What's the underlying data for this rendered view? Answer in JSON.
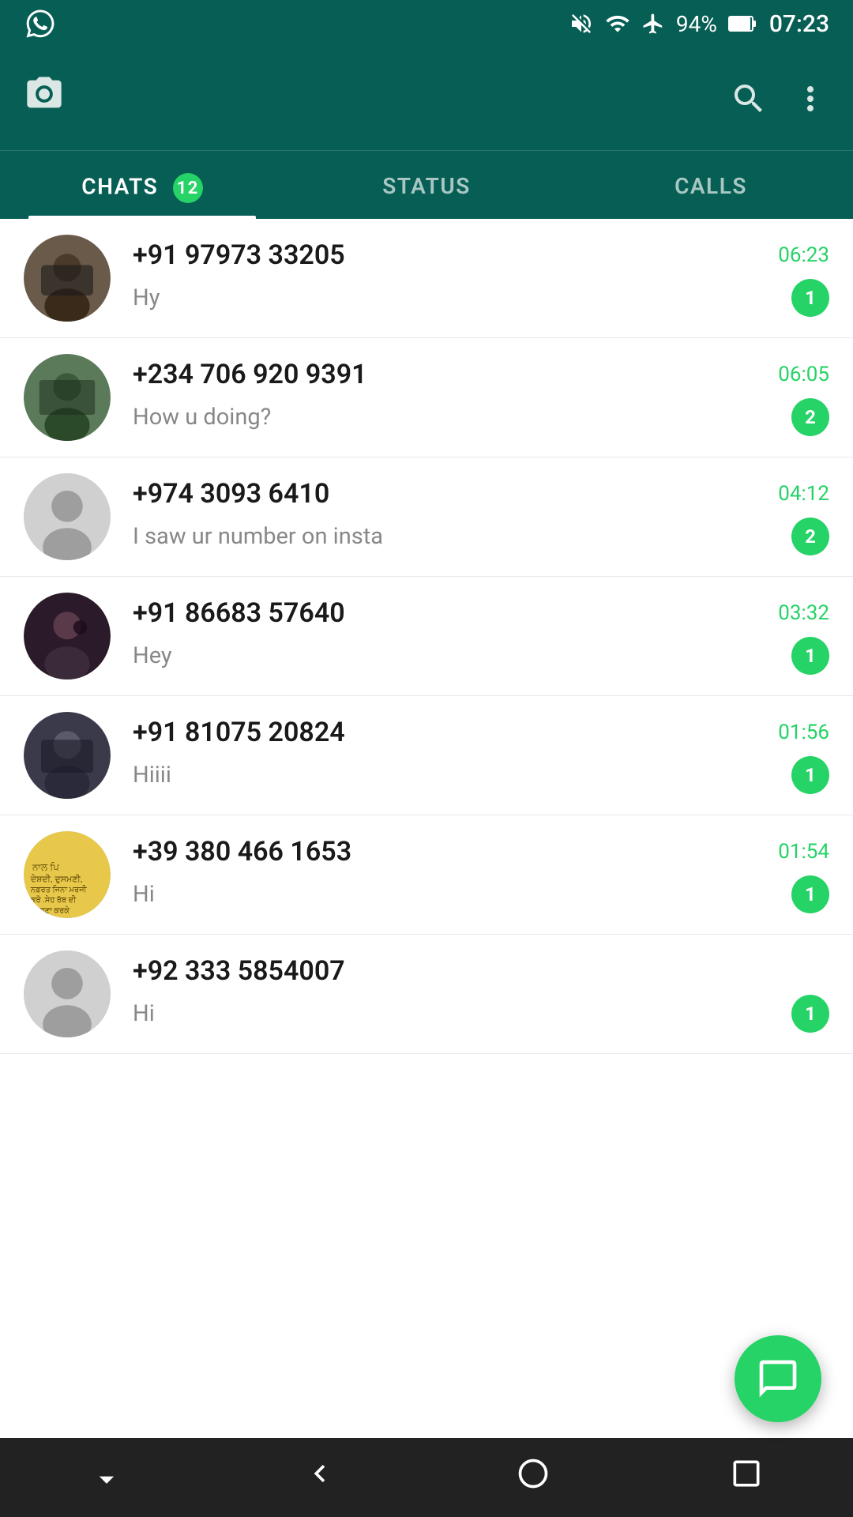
{
  "statusBar": {
    "time": "07:23",
    "battery": "94%",
    "icons": [
      "mute-icon",
      "wifi-icon",
      "airplane-icon",
      "battery-icon"
    ]
  },
  "header": {
    "cameraLabel": "📷",
    "appName": "WhatsApp"
  },
  "tabs": [
    {
      "id": "chats",
      "label": "CHATS",
      "badge": "12",
      "active": true
    },
    {
      "id": "status",
      "label": "STATUS",
      "badge": null,
      "active": false
    },
    {
      "id": "calls",
      "label": "CALLS",
      "badge": null,
      "active": false
    }
  ],
  "chats": [
    {
      "id": 1,
      "name": "+91 97973 33205",
      "lastMessage": "Hy",
      "time": "06:23",
      "unread": "1",
      "avatarClass": "avatar-img-1"
    },
    {
      "id": 2,
      "name": "+234 706 920 9391",
      "lastMessage": "How u doing?",
      "time": "06:05",
      "unread": "2",
      "avatarClass": "avatar-img-2"
    },
    {
      "id": 3,
      "name": "+974 3093 6410",
      "lastMessage": "I saw ur number on insta",
      "time": "04:12",
      "unread": "2",
      "avatarClass": "avatar-img-3"
    },
    {
      "id": 4,
      "name": "+91 86683 57640",
      "lastMessage": "Hey",
      "time": "03:32",
      "unread": "1",
      "avatarClass": "avatar-img-4"
    },
    {
      "id": 5,
      "name": "+91 81075 20824",
      "lastMessage": "Hiiii",
      "time": "01:56",
      "unread": "1",
      "avatarClass": "avatar-img-5"
    },
    {
      "id": 6,
      "name": "+39 380 466 1653",
      "lastMessage": "Hi",
      "time": "01:54",
      "unread": "1",
      "avatarClass": "avatar-img-6"
    },
    {
      "id": 7,
      "name": "+92 333 5854007",
      "lastMessage": "Hi",
      "time": "",
      "unread": "1",
      "avatarClass": "avatar-img-7"
    }
  ],
  "fab": {
    "icon": "💬",
    "label": "New Chat"
  },
  "navBar": {
    "buttons": [
      "chevron-down",
      "back",
      "home",
      "square"
    ]
  },
  "colors": {
    "headerBg": "#075e54",
    "accent": "#25d366",
    "activeTab": "#ffffff",
    "inactiveTab": "rgba(255,255,255,0.65)"
  }
}
